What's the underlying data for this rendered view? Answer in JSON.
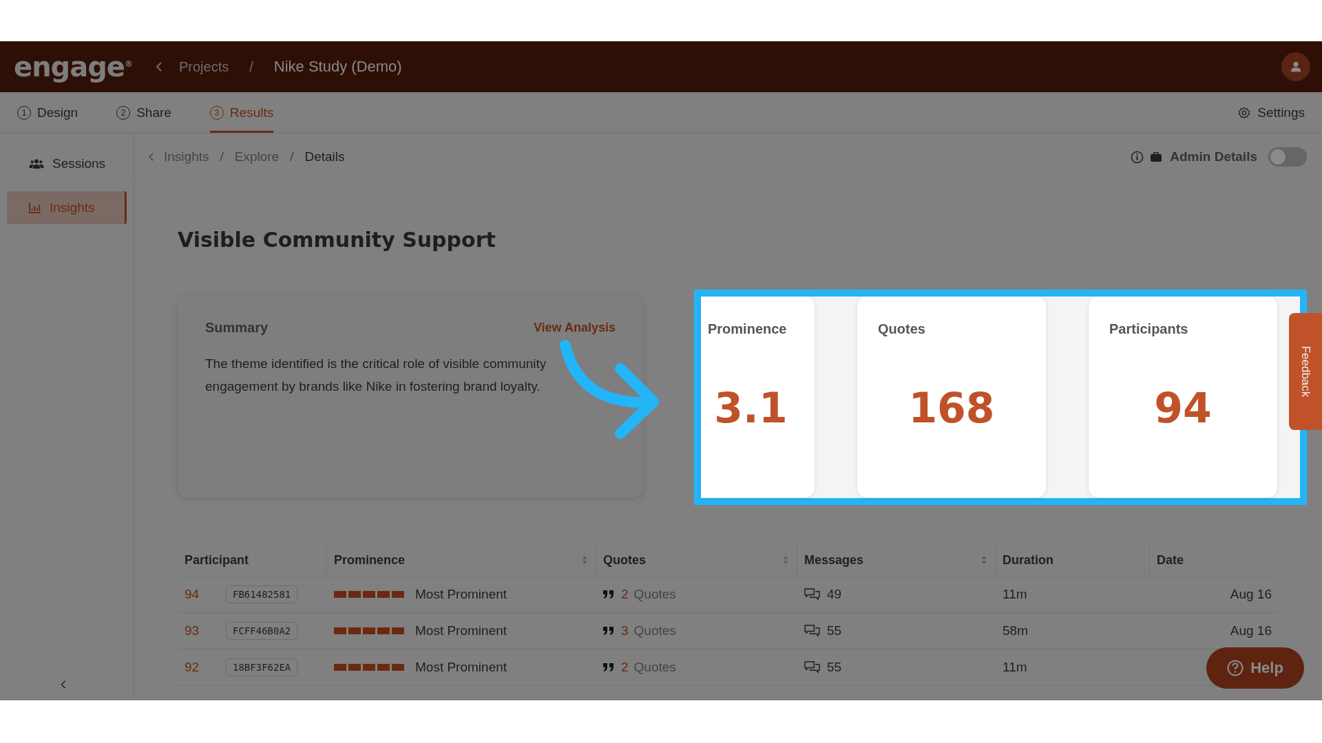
{
  "header": {
    "logo": "engage$^{®}$",
    "separator": "/",
    "breadcrumb": [
      {
        "label": "Projects"
      },
      {
        "label": "Nike Study (Demo)"
      }
    ]
  },
  "tabs": [
    {
      "number": "1",
      "label": "Design",
      "selected": false
    },
    {
      "number": "2",
      "label": "Share",
      "selected": false
    },
    {
      "number": "3",
      "label": "Results",
      "selected": true
    }
  ],
  "settings": "Settings",
  "sidebar": {
    "items": [
      {
        "label": "Sessions",
        "selected": false
      },
      {
        "label": "Insights",
        "selected": true
      }
    ]
  },
  "breadcrumb": {
    "separator": "/",
    "items": [
      {
        "label": "Insights"
      },
      {
        "label": "Explore"
      },
      {
        "label": "Details"
      }
    ]
  },
  "admin_details": {
    "label": "Admin Details",
    "on": false
  },
  "title": "Visible Community Support",
  "summary": {
    "heading": "Summary",
    "link": "View Analysis",
    "text": "The theme identified is the critical role of visible community engagement by brands like Nike in fostering brand loyalty."
  },
  "stats": [
    {
      "label": "Prominence",
      "value": "3.1"
    },
    {
      "label": "Quotes",
      "value": "168"
    },
    {
      "label": "Participants",
      "value": "94"
    }
  ],
  "feedback_tab": "Feedback",
  "table": {
    "columns": [
      {
        "label": "Participant",
        "sortable": false
      },
      {
        "label": "Prominence",
        "sortable": true
      },
      {
        "label": "Quotes",
        "sortable": true
      },
      {
        "label": "Messages",
        "sortable": true
      },
      {
        "label": "Duration",
        "sortable": false
      },
      {
        "label": "Date",
        "sortable": false
      }
    ],
    "rows": [
      {
        "number": "94",
        "id": "FB61482581",
        "stars": 5,
        "prominence": "Most Prominent",
        "quotes_count": "2",
        "quotes_label": "Quotes",
        "messages": "49",
        "duration": "11m",
        "date": "Aug 16"
      },
      {
        "number": "93",
        "id": "FCFF46B0A2",
        "stars": 5,
        "prominence": "Most Prominent",
        "quotes_count": "3",
        "quotes_label": "Quotes",
        "messages": "55",
        "duration": "58m",
        "date": "Aug 16"
      },
      {
        "number": "92",
        "id": "18BF3F62EA",
        "stars": 5,
        "prominence": "Most Prominent",
        "quotes_count": "2",
        "quotes_label": "Quotes",
        "messages": "55",
        "duration": "11m"
      }
    ]
  },
  "help": "Help"
}
